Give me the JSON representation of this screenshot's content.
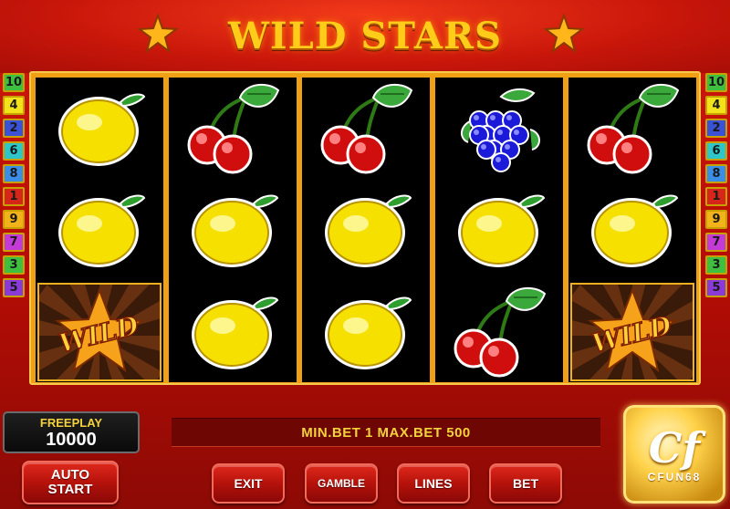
{
  "title": "WILD STARS",
  "paylines_left": [
    {
      "num": "10",
      "color": "#3fbf3f"
    },
    {
      "num": "4",
      "color": "#f2e21a"
    },
    {
      "num": "2",
      "color": "#3a52d6"
    },
    {
      "num": "6",
      "color": "#2ec6c6"
    },
    {
      "num": "8",
      "color": "#3a8ee6"
    },
    {
      "num": "1",
      "color": "#d6261a"
    },
    {
      "num": "9",
      "color": "#f2b21a"
    },
    {
      "num": "7",
      "color": "#c43ad6"
    },
    {
      "num": "3",
      "color": "#3fbf3f"
    },
    {
      "num": "5",
      "color": "#8a3ad6"
    }
  ],
  "paylines_right": [
    {
      "num": "10",
      "color": "#3fbf3f"
    },
    {
      "num": "4",
      "color": "#f2e21a"
    },
    {
      "num": "2",
      "color": "#3a52d6"
    },
    {
      "num": "6",
      "color": "#2ec6c6"
    },
    {
      "num": "8",
      "color": "#3a8ee6"
    },
    {
      "num": "1",
      "color": "#d6261a"
    },
    {
      "num": "9",
      "color": "#f2b21a"
    },
    {
      "num": "7",
      "color": "#c43ad6"
    },
    {
      "num": "3",
      "color": "#3fbf3f"
    },
    {
      "num": "5",
      "color": "#8a3ad6"
    }
  ],
  "reels": [
    [
      "lemon",
      "lemon",
      "wild"
    ],
    [
      "cherry",
      "lemon",
      "lemon"
    ],
    [
      "cherry",
      "lemon",
      "lemon"
    ],
    [
      "grapes",
      "lemon",
      "cherry"
    ],
    [
      "cherry",
      "lemon",
      "wild"
    ]
  ],
  "wild_label": "WILD",
  "freeplay": {
    "label": "FREEPLAY",
    "value": "10000"
  },
  "bet_info": "MIN.BET 1 MAX.BET 500",
  "buttons": {
    "auto_start": [
      "AUTO",
      "START"
    ],
    "exit": "EXIT",
    "gamble": "GAMBLE",
    "lines": "LINES",
    "bet": "BET"
  },
  "logo": {
    "mark": "Cf",
    "name": "CFUN68"
  }
}
